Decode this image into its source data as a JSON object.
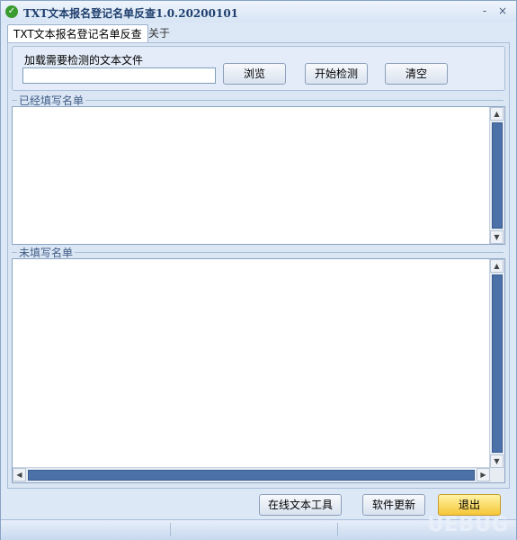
{
  "window": {
    "title": "TXT文本报名登记名单反查1.0.20200101",
    "minimize_glyph": "-",
    "close_glyph": "×"
  },
  "tabs": [
    {
      "label": "TXT文本报名登记名单反查",
      "active": true
    },
    {
      "label": "关于",
      "active": false
    }
  ],
  "load": {
    "label": "加载需要检测的文本文件",
    "file_value": "",
    "browse_label": "浏览",
    "start_label": "开始检测",
    "clear_label": "清空"
  },
  "filled_list": {
    "title": "已经填写名单",
    "content": ""
  },
  "unfilled_list": {
    "title": "未填写名单",
    "content": ""
  },
  "footer": {
    "online_tools_label": "在线文本工具",
    "update_label": "软件更新",
    "exit_label": "退出"
  },
  "watermark": "UEBUG",
  "icons": {
    "app": "check-circle-icon",
    "up": "▲",
    "down": "▼",
    "left": "◀",
    "right": "▶"
  },
  "colors": {
    "scroll_thumb": "#4b71a8",
    "exit_button": "#f6c637",
    "frame_bg": "#dbe6f4"
  }
}
